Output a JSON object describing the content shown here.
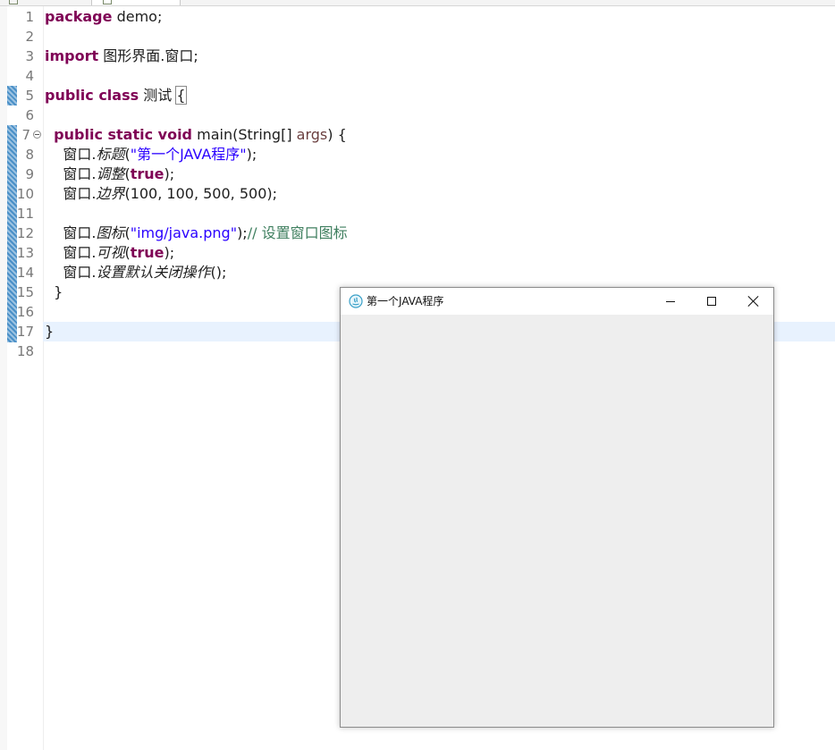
{
  "editor": {
    "line_numbers": [
      "1",
      "2",
      "3",
      "4",
      "5",
      "6",
      "7",
      "8",
      "9",
      "10",
      "11",
      "12",
      "13",
      "14",
      "15",
      "16",
      "17",
      "18"
    ],
    "code": {
      "l1_kw": "package",
      "l1_rest": " demo;",
      "l3_kw": "import",
      "l3_rest": " 图形界面.窗口;",
      "l5_kw": "public class",
      "l5_name": " 测试 ",
      "l5_brace": "{",
      "l7_indent": "  ",
      "l7_kw": "public static void",
      "l7_main": " main(String[] ",
      "l7_param": "args",
      "l7_end": ") {",
      "l8_obj": "    窗口.",
      "l8_method": "标题",
      "l8_open": "(",
      "l8_str": "\"第一个JAVA程序\"",
      "l8_end": ");",
      "l9_obj": "    窗口.",
      "l9_method": "调整",
      "l9_open": "(",
      "l9_kw": "true",
      "l9_end": ");",
      "l10_obj": "    窗口.",
      "l10_method": "边界",
      "l10_args": "(100, 100, 500, 500);",
      "l12_obj": "    窗口.",
      "l12_method": "图标",
      "l12_open": "(",
      "l12_str": "\"img/java.png\"",
      "l12_end": ");",
      "l12_cmt": "// 设置窗口图标",
      "l13_obj": "    窗口.",
      "l13_method": "可视",
      "l13_open": "(",
      "l13_kw": "true",
      "l13_end": ");",
      "l14_obj": "    窗口.",
      "l14_method": "设置默认关闭操作",
      "l14_args": "();",
      "l15": "  }",
      "l17": "}"
    }
  },
  "window": {
    "title": "第一个JAVA程序",
    "icon": "java-app-icon",
    "buttons": [
      "minimize-icon",
      "maximize-icon",
      "close-icon"
    ]
  },
  "colors": {
    "keyword": "#7f0055",
    "string": "#2a00ff",
    "comment": "#3f7f5f",
    "current_line": "#e8f2fe",
    "change_bar": "#4a90c8"
  }
}
